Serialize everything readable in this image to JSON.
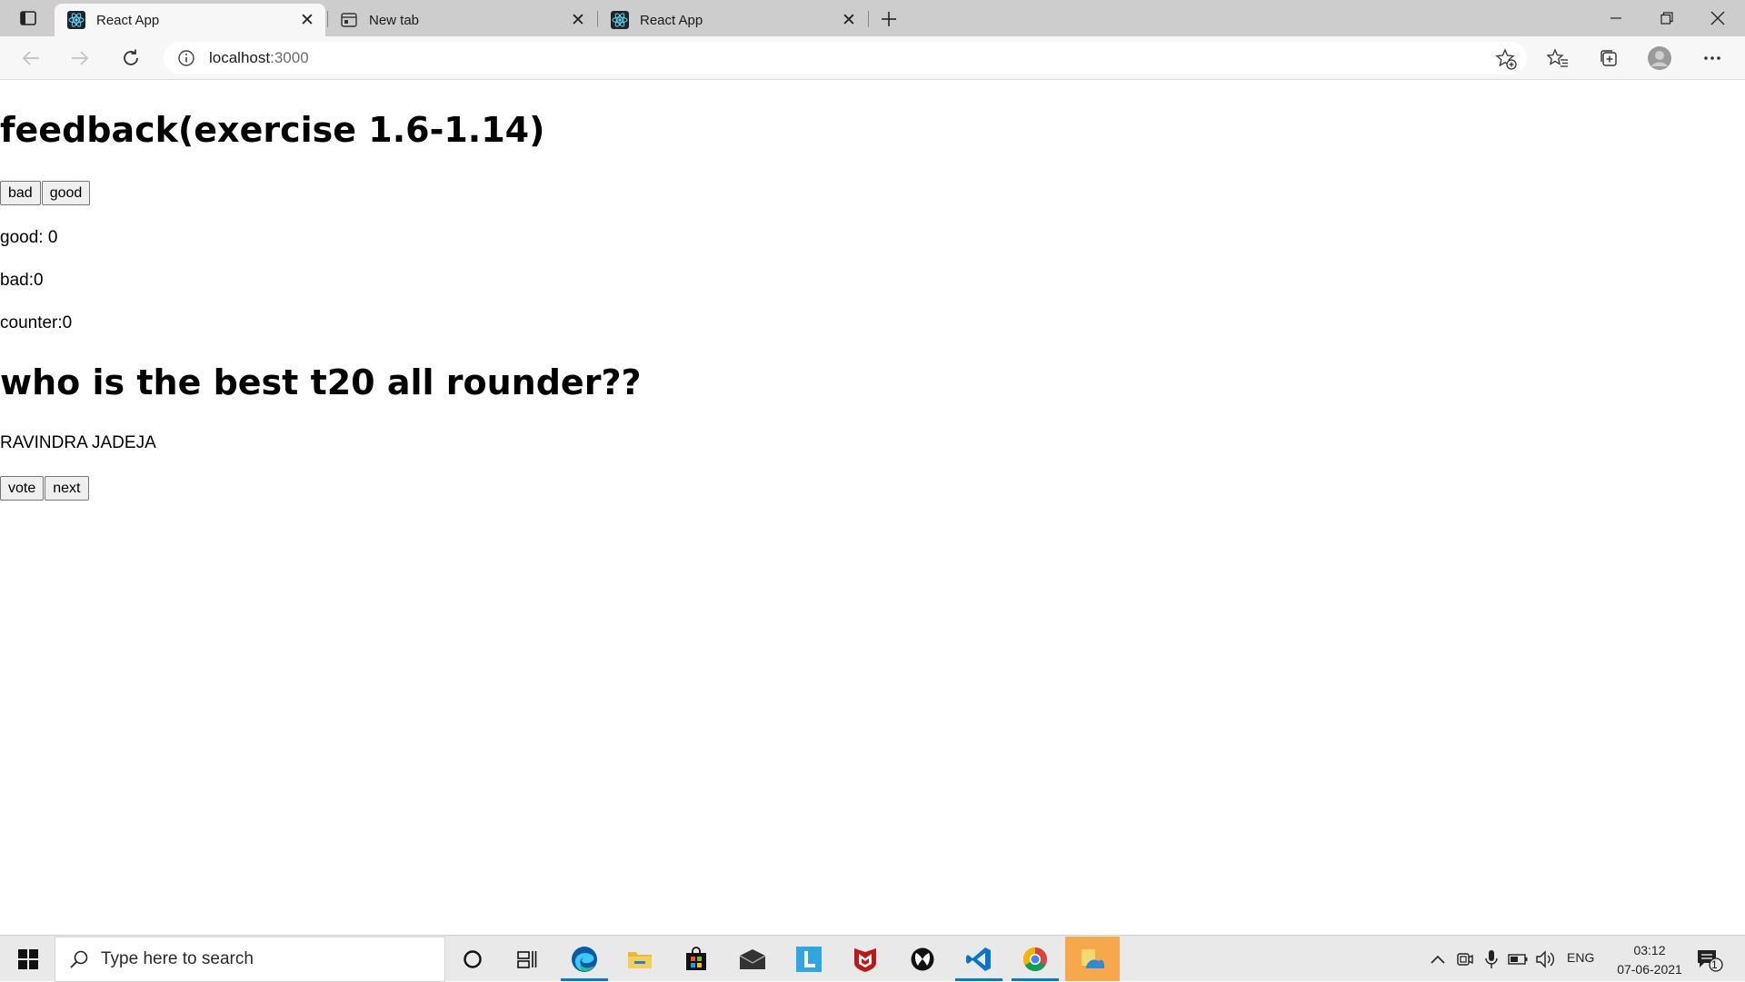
{
  "browser": {
    "tabs": [
      {
        "title": "React App",
        "favicon": "react-logo-icon",
        "active": true
      },
      {
        "title": "New tab",
        "favicon": "new-tab-page-icon",
        "active": false
      },
      {
        "title": "React App",
        "favicon": "react-logo-icon",
        "active": false
      }
    ],
    "address": {
      "host": "localhost",
      "port": ":3000"
    }
  },
  "page": {
    "feedback_heading": "feedback(exercise 1.6-1.14)",
    "buttons": {
      "bad": "bad",
      "good": "good"
    },
    "stats": {
      "good": "good: 0",
      "bad": "bad:0",
      "counter": "counter:0"
    },
    "anecdote_heading": "who is the best t20 all rounder??",
    "anecdote": "RAVINDRA JADEJA",
    "anecdote_buttons": {
      "vote": "vote",
      "next": "next"
    }
  },
  "taskbar": {
    "search_placeholder": "Type here to search",
    "apps": [
      "cortana-icon",
      "task-view-icon",
      "edge-icon",
      "file-explorer-icon",
      "store-icon",
      "mail-icon",
      "l-app-icon",
      "mcafee-icon",
      "xbox-icon",
      "vscode-icon",
      "chrome-icon",
      "photos-icon"
    ],
    "language": "ENG",
    "time": "03:12",
    "date": "07-06-2021",
    "notification_count": "1"
  },
  "colors": {
    "tabstrip": "#cdcdcd",
    "toolbar": "#f7f7f7",
    "taskbar": "#e9e9e9",
    "accent": "#0078d4",
    "highlight_app": "#f7a84a"
  }
}
